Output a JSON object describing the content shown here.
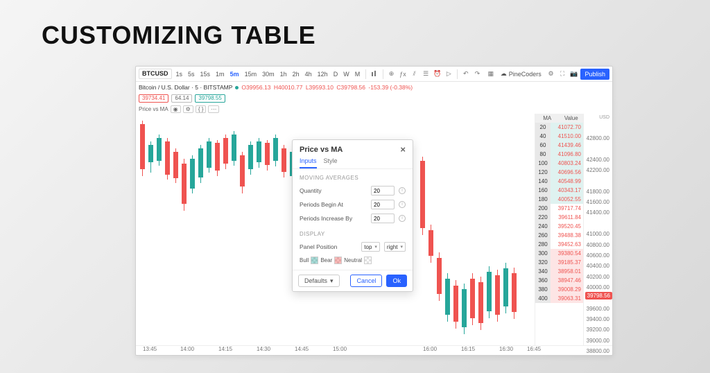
{
  "page_title": "CUSTOMIZING TABLE",
  "toolbar": {
    "symbol": "BTCUSD",
    "timeframes": [
      "1s",
      "5s",
      "15s",
      "1m",
      "5m",
      "15m",
      "30m",
      "1h",
      "2h",
      "4h",
      "12h",
      "D",
      "W",
      "M"
    ],
    "active_tf": "5m",
    "pine": "PineCoders",
    "publish": "Publish"
  },
  "legend": {
    "name": "Bitcoin / U.S. Dollar · 5 · BITSTAMP",
    "o": "O39956.13",
    "h": "H40010.77",
    "l": "L39593.10",
    "c": "C39798.56",
    "delta": "-153.39 (-0.38%)"
  },
  "pills": {
    "left": "39734.41",
    "mid": "64.14",
    "right": "39798.55"
  },
  "indicator_row": {
    "name": "Price vs MA"
  },
  "modal": {
    "title": "Price vs MA",
    "tabs": {
      "inputs": "Inputs",
      "style": "Style"
    },
    "section_ma": "MOVING AVERAGES",
    "qty_label": "Quantity",
    "qty_value": "20",
    "begin_label": "Periods Begin At",
    "begin_value": "20",
    "incr_label": "Periods Increase By",
    "incr_value": "20",
    "section_display": "DISPLAY",
    "panel_label": "Panel Position",
    "panel_v": "top",
    "panel_h": "right",
    "bull": "Bull",
    "bear": "Bear",
    "neutral": "Neutral",
    "defaults": "Defaults",
    "cancel": "Cancel",
    "ok": "Ok"
  },
  "ma_table": {
    "header": {
      "ma": "MA",
      "value": "Value"
    },
    "rows": [
      {
        "p": 20,
        "v": "41072.70",
        "c": "bull"
      },
      {
        "p": 40,
        "v": "41510.00",
        "c": "bull"
      },
      {
        "p": 60,
        "v": "41439.46",
        "c": "bull"
      },
      {
        "p": 80,
        "v": "41096.80",
        "c": "bull"
      },
      {
        "p": 100,
        "v": "40803.24",
        "c": "bull"
      },
      {
        "p": 120,
        "v": "40696.56",
        "c": "bull"
      },
      {
        "p": 140,
        "v": "40548.99",
        "c": "bull"
      },
      {
        "p": 160,
        "v": "40343.17",
        "c": "bull"
      },
      {
        "p": 180,
        "v": "40052.55",
        "c": "bull"
      },
      {
        "p": 200,
        "v": "39717.74",
        "c": "neu"
      },
      {
        "p": 220,
        "v": "39611.84",
        "c": "neu"
      },
      {
        "p": 240,
        "v": "39520.45",
        "c": "neu"
      },
      {
        "p": 260,
        "v": "39488.38",
        "c": "neu"
      },
      {
        "p": 280,
        "v": "39452.63",
        "c": "neu"
      },
      {
        "p": 300,
        "v": "39380.54",
        "c": "bear"
      },
      {
        "p": 320,
        "v": "39185.37",
        "c": "bear"
      },
      {
        "p": 340,
        "v": "38958.01",
        "c": "bear"
      },
      {
        "p": 360,
        "v": "38947.46",
        "c": "bear"
      },
      {
        "p": 380,
        "v": "39008.29",
        "c": "bear"
      },
      {
        "p": 400,
        "v": "39063.31",
        "c": "bear"
      }
    ]
  },
  "yaxis": {
    "top_label": "USD",
    "ticks": [
      42800,
      42400,
      42200,
      41800,
      41600,
      41400,
      41000,
      40800,
      40600,
      40400,
      40200,
      40000,
      39600,
      39400,
      39200,
      39000,
      38800
    ],
    "price_tag": "39798.56"
  },
  "xaxis": [
    "13:45",
    "14:00",
    "14:15",
    "14:30",
    "14:45",
    "15:00",
    "16:00",
    "16:15",
    "16:30",
    "16:45"
  ],
  "chart_data": {
    "type": "candlestick",
    "symbol": "BTCUSD",
    "timeframe": "5m",
    "ylim": [
      38800,
      43100
    ],
    "candles": [
      {
        "x": 6,
        "whi": 10,
        "wlo": 90,
        "bhi": 15,
        "blo": 80,
        "d": "dn"
      },
      {
        "x": 18,
        "whi": 40,
        "wlo": 85,
        "bhi": 45,
        "blo": 70,
        "d": "up"
      },
      {
        "x": 30,
        "whi": 30,
        "wlo": 75,
        "bhi": 35,
        "blo": 68,
        "d": "up"
      },
      {
        "x": 42,
        "whi": 35,
        "wlo": 95,
        "bhi": 40,
        "blo": 88,
        "d": "dn"
      },
      {
        "x": 54,
        "whi": 50,
        "wlo": 100,
        "bhi": 55,
        "blo": 93,
        "d": "dn"
      },
      {
        "x": 66,
        "whi": 65,
        "wlo": 140,
        "bhi": 72,
        "blo": 130,
        "d": "dn"
      },
      {
        "x": 78,
        "whi": 60,
        "wlo": 115,
        "bhi": 65,
        "blo": 108,
        "d": "up"
      },
      {
        "x": 90,
        "whi": 45,
        "wlo": 100,
        "bhi": 50,
        "blo": 92,
        "d": "up"
      },
      {
        "x": 102,
        "whi": 35,
        "wlo": 85,
        "bhi": 40,
        "blo": 78,
        "d": "up"
      },
      {
        "x": 114,
        "whi": 38,
        "wlo": 90,
        "bhi": 42,
        "blo": 82,
        "d": "dn"
      },
      {
        "x": 126,
        "whi": 30,
        "wlo": 80,
        "bhi": 35,
        "blo": 72,
        "d": "dn"
      },
      {
        "x": 138,
        "whi": 25,
        "wlo": 75,
        "bhi": 30,
        "blo": 68,
        "d": "up"
      },
      {
        "x": 150,
        "whi": 55,
        "wlo": 115,
        "bhi": 60,
        "blo": 105,
        "d": "dn"
      },
      {
        "x": 162,
        "whi": 40,
        "wlo": 88,
        "bhi": 45,
        "blo": 80,
        "d": "up"
      },
      {
        "x": 174,
        "whi": 35,
        "wlo": 78,
        "bhi": 40,
        "blo": 70,
        "d": "up"
      },
      {
        "x": 186,
        "whi": 38,
        "wlo": 82,
        "bhi": 42,
        "blo": 74,
        "d": "dn"
      },
      {
        "x": 198,
        "whi": 30,
        "wlo": 76,
        "bhi": 35,
        "blo": 68,
        "d": "up"
      },
      {
        "x": 210,
        "whi": 45,
        "wlo": 92,
        "bhi": 50,
        "blo": 84,
        "d": "dn"
      },
      {
        "x": 222,
        "whi": 50,
        "wlo": 98,
        "bhi": 55,
        "blo": 90,
        "d": "up"
      },
      {
        "x": 234,
        "whi": 40,
        "wlo": 86,
        "bhi": 45,
        "blo": 78,
        "d": "up"
      },
      {
        "x": 246,
        "whi": 48,
        "wlo": 94,
        "bhi": 52,
        "blo": 86,
        "d": "dn"
      },
      {
        "x": 258,
        "whi": 44,
        "wlo": 90,
        "bhi": 48,
        "blo": 82,
        "d": "dn"
      },
      {
        "x": 270,
        "whi": 40,
        "wlo": 86,
        "bhi": 44,
        "blo": 78,
        "d": "up"
      },
      {
        "x": 282,
        "whi": 50,
        "wlo": 96,
        "bhi": 54,
        "blo": 88,
        "d": "dn"
      },
      {
        "x": 294,
        "whi": 55,
        "wlo": 102,
        "bhi": 60,
        "blo": 94,
        "d": "up"
      },
      {
        "x": 306,
        "whi": 48,
        "wlo": 94,
        "bhi": 52,
        "blo": 86,
        "d": "dn"
      },
      {
        "x": 410,
        "whi": 62,
        "wlo": 175,
        "bhi": 68,
        "blo": 165,
        "d": "dn"
      },
      {
        "x": 422,
        "whi": 160,
        "wlo": 215,
        "bhi": 168,
        "blo": 205,
        "d": "dn"
      },
      {
        "x": 434,
        "whi": 200,
        "wlo": 270,
        "bhi": 208,
        "blo": 260,
        "d": "dn"
      },
      {
        "x": 446,
        "whi": 230,
        "wlo": 300,
        "bhi": 238,
        "blo": 290,
        "d": "up"
      },
      {
        "x": 458,
        "whi": 240,
        "wlo": 310,
        "bhi": 248,
        "blo": 300,
        "d": "dn"
      },
      {
        "x": 470,
        "whi": 245,
        "wlo": 318,
        "bhi": 253,
        "blo": 308,
        "d": "up"
      },
      {
        "x": 482,
        "whi": 230,
        "wlo": 305,
        "bhi": 238,
        "blo": 295,
        "d": "dn"
      },
      {
        "x": 494,
        "whi": 235,
        "wlo": 312,
        "bhi": 243,
        "blo": 302,
        "d": "dn"
      },
      {
        "x": 506,
        "whi": 220,
        "wlo": 295,
        "bhi": 228,
        "blo": 285,
        "d": "up"
      },
      {
        "x": 518,
        "whi": 225,
        "wlo": 300,
        "bhi": 233,
        "blo": 290,
        "d": "dn"
      },
      {
        "x": 530,
        "whi": 215,
        "wlo": 288,
        "bhi": 223,
        "blo": 278,
        "d": "up"
      },
      {
        "x": 542,
        "whi": 222,
        "wlo": 296,
        "bhi": 230,
        "blo": 286,
        "d": "dn"
      }
    ]
  }
}
